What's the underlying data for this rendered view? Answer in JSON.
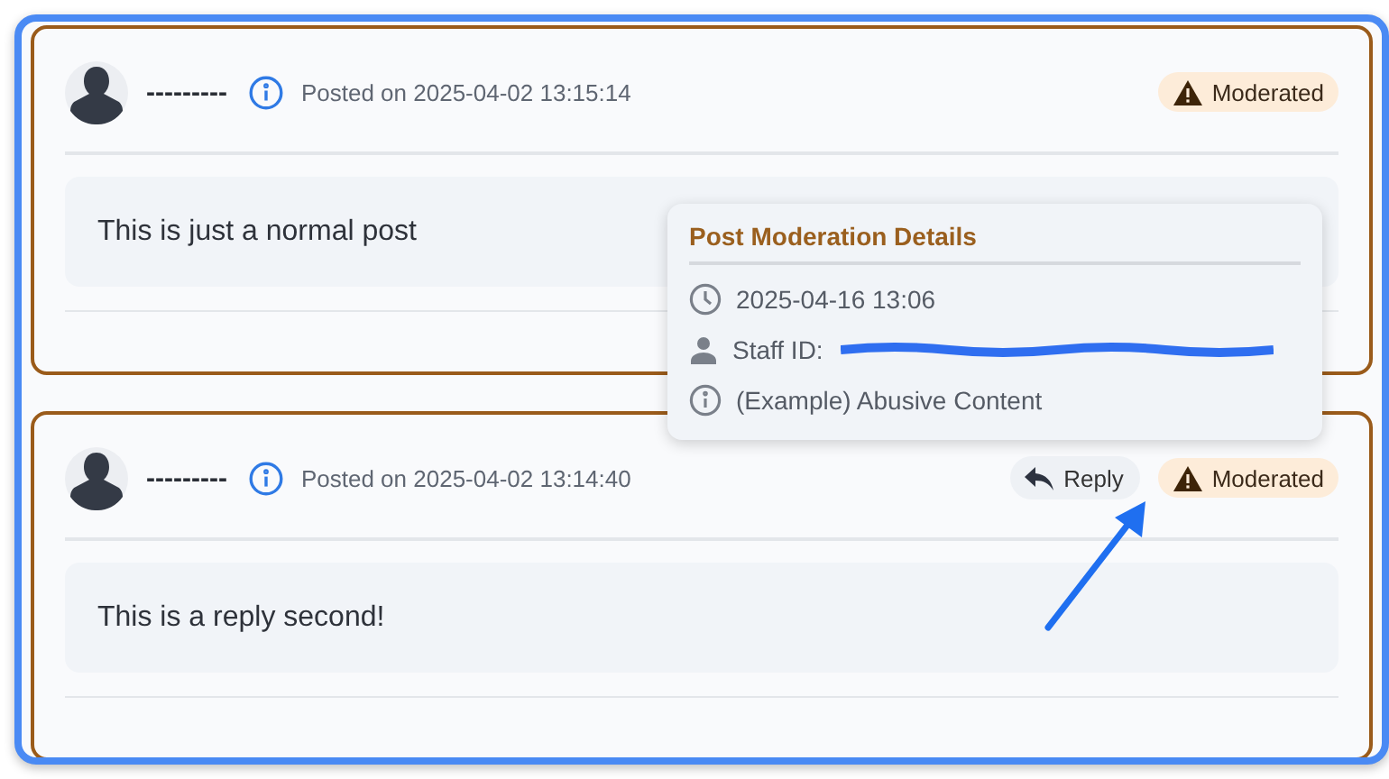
{
  "posts": [
    {
      "author": "---------",
      "posted": "Posted on 2025-04-02 13:15:14",
      "body": "This is just a normal post",
      "badge": "Moderated"
    },
    {
      "author": "---------",
      "posted": "Posted on 2025-04-02 13:14:40",
      "body": "This is a reply second!",
      "reply": "Reply",
      "badge": "Moderated"
    }
  ],
  "tooltip": {
    "title": "Post Moderation Details",
    "rows": [
      {
        "kind": "time",
        "text": "2025-04-16 13:06"
      },
      {
        "kind": "staff",
        "text": "Staff ID:"
      },
      {
        "kind": "reason",
        "text": "(Example) Abusive Content"
      }
    ]
  }
}
